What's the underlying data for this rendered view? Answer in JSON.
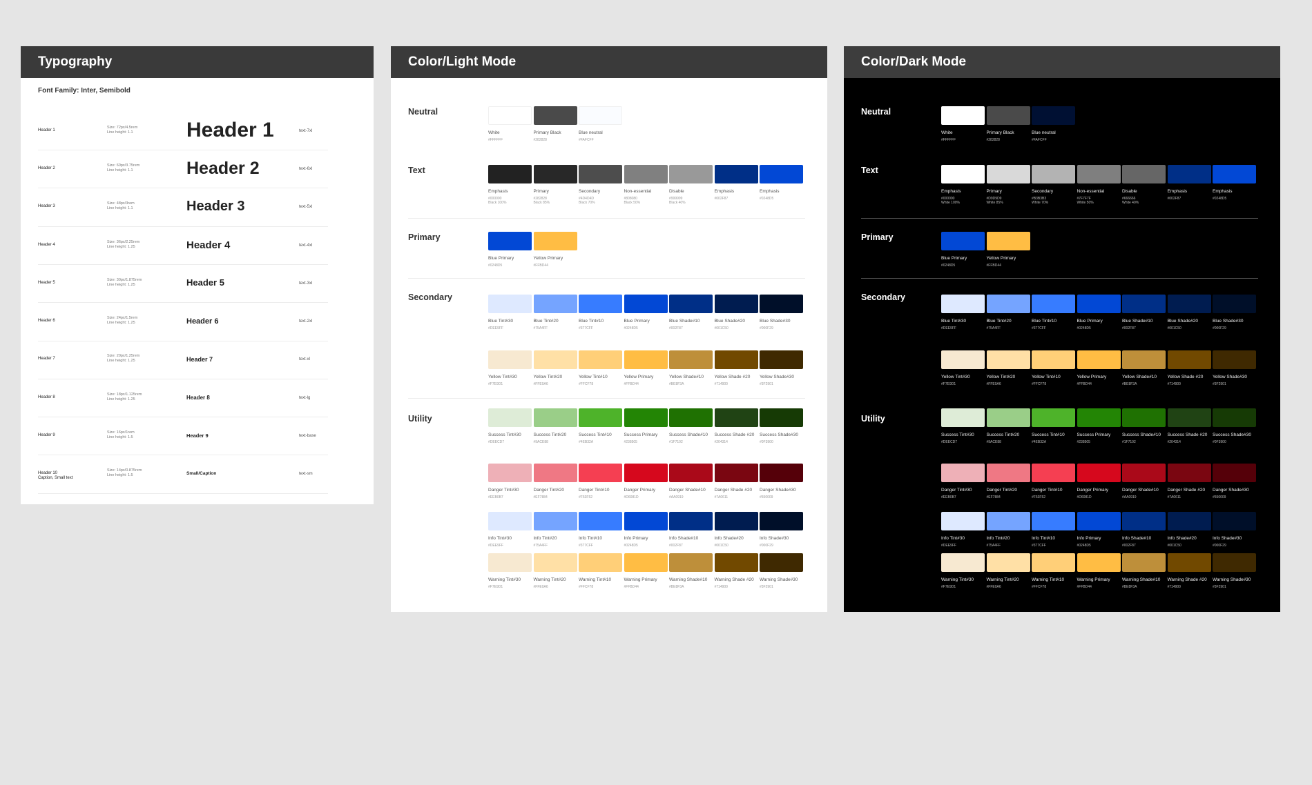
{
  "panels": {
    "typography_title": "Typography",
    "light_title": "Color/Light Mode",
    "dark_title": "Color/Dark Mode"
  },
  "typography": {
    "font_family": "Font Family: Inter, Semibold",
    "rows": [
      {
        "name": "Header 1",
        "size": "Size: 72px/4.5rem",
        "line": "Line height: 1.1",
        "sample": "Header 1",
        "cls": "text-7xl"
      },
      {
        "name": "Header 2",
        "size": "Size: 60px/3.75rem",
        "line": "Line height: 1.1",
        "sample": "Header 2",
        "cls": "text-6xl"
      },
      {
        "name": "Header 3",
        "size": "Size: 48px/3rem",
        "line": "Line height: 1.1",
        "sample": "Header 3",
        "cls": "text-5xl"
      },
      {
        "name": "Header 4",
        "size": "Size: 36px/2.25rem",
        "line": "Line height: 1.25",
        "sample": "Header 4",
        "cls": "text-4xl"
      },
      {
        "name": "Header 5",
        "size": "Size: 30px/1.875rem",
        "line": "Line height: 1.25",
        "sample": "Header 5",
        "cls": "text-3xl"
      },
      {
        "name": "Header 6",
        "size": "Size: 24px/1.5rem",
        "line": "Line height: 1.25",
        "sample": "Header 6",
        "cls": "text-2xl"
      },
      {
        "name": "Header 7",
        "size": "Size: 20px/1.25rem",
        "line": "Line height: 1.25",
        "sample": "Header 7",
        "cls": "text-xl"
      },
      {
        "name": "Header 8",
        "size": "Size: 18px/1.125rem",
        "line": "Line height: 1.25",
        "sample": "Header 8",
        "cls": "text-lg"
      },
      {
        "name": "Header 9",
        "size": "Size: 16px/1rem",
        "line": "Line height: 1.5",
        "sample": "Header 9",
        "cls": "text-base"
      },
      {
        "name": "Header 10\nCaption, Small text",
        "size": "Size: 14px/0.875rem",
        "line": "Line height: 1.5",
        "sample": "Small/Caption",
        "cls": "text-sm"
      }
    ]
  },
  "light": {
    "labels": {
      "neutral": "Neutral",
      "text": "Text",
      "primary": "Primary",
      "secondary": "Secondary",
      "utility": "Utility"
    },
    "neutral": [
      {
        "name": "White",
        "hex": "#FFFFFF",
        "color": "#FFFFFF"
      },
      {
        "name": "Primary Black",
        "hex": "#282828",
        "color": "#4a4a4a"
      },
      {
        "name": "Blue neutral",
        "hex": "#FAFCFF",
        "color": "#FAFCFF"
      }
    ],
    "text": [
      {
        "name": "Emphasis",
        "hex": "#000000",
        "extra": "Black 100%",
        "color": "#222222"
      },
      {
        "name": "Primary",
        "hex": "#282828",
        "extra": "Black 85%",
        "color": "#282828"
      },
      {
        "name": "Secondary",
        "hex": "#4D4D4D",
        "extra": "Black 70%",
        "color": "#4D4D4D"
      },
      {
        "name": "Non-essential",
        "hex": "#808080",
        "extra": "Black 50%",
        "color": "#808080"
      },
      {
        "name": "Disable",
        "hex": "#999999",
        "extra": "Black 40%",
        "color": "#999999"
      },
      {
        "name": "Emphasis",
        "hex": "#002F87",
        "extra": "",
        "color": "#002F87"
      },
      {
        "name": "Emphasis",
        "hex": "#0248D5",
        "extra": "",
        "color": "#0248D5"
      }
    ],
    "primary": [
      {
        "name": "Blue Primary",
        "hex": "#0248D5",
        "color": "#0248D5"
      },
      {
        "name": "Yellow Primary",
        "hex": "#FFBD44",
        "color": "#FFBD44"
      }
    ],
    "secondary_blue": [
      {
        "name": "Blue Tint#30",
        "hex": "#DEE9FF",
        "color": "#DEE9FF"
      },
      {
        "name": "Blue Tint#20",
        "hex": "#75A4FF",
        "color": "#75A4FF"
      },
      {
        "name": "Blue Tint#10",
        "hex": "#377CFF",
        "color": "#377CFF"
      },
      {
        "name": "Blue Primary",
        "hex": "#0248D5",
        "color": "#0248D5"
      },
      {
        "name": "Blue Shade#10",
        "hex": "#002F87",
        "color": "#002F87"
      },
      {
        "name": "Blue Shade#20",
        "hex": "#001C50",
        "color": "#001C50"
      },
      {
        "name": "Blue Shade#30",
        "hex": "#000F29",
        "color": "#000F29"
      }
    ],
    "secondary_yellow": [
      {
        "name": "Yellow Tint#30",
        "hex": "#F7E9D1",
        "color": "#F7E9D1"
      },
      {
        "name": "Yellow Tint#20",
        "hex": "#FFE0A6",
        "color": "#FFE0A6"
      },
      {
        "name": "Yellow Tint#10",
        "hex": "#FFCF78",
        "color": "#FFCF78"
      },
      {
        "name": "Yellow Primary",
        "hex": "#FFBD44",
        "color": "#FFBD44"
      },
      {
        "name": "Yellow Shade#10",
        "hex": "#BE8F3A",
        "color": "#BE8F3A"
      },
      {
        "name": "Yellow Shade #20",
        "hex": "#714900",
        "color": "#714900"
      },
      {
        "name": "Yellow Shade#30",
        "hex": "#3F2901",
        "color": "#3F2901"
      }
    ],
    "success": [
      {
        "name": "Success Tint#30",
        "hex": "#DEECD7",
        "color": "#DEECD7"
      },
      {
        "name": "Success Tint#20",
        "hex": "#9ACE88",
        "color": "#9ACE88"
      },
      {
        "name": "Success Tint#10",
        "hex": "#4EB32A",
        "color": "#4EB32A"
      },
      {
        "name": "Success Primary",
        "hex": "#238505",
        "color": "#238505"
      },
      {
        "name": "Success Shade#10",
        "hex": "#1F7102",
        "color": "#1F7102"
      },
      {
        "name": "Success Shade #20",
        "hex": "#204314",
        "color": "#204314"
      },
      {
        "name": "Success Shade#30",
        "hex": "#0F3900",
        "color": "#163A05"
      }
    ],
    "danger": [
      {
        "name": "Danger Tint#30",
        "hex": "#EEB0B7",
        "color": "#EEB0B7"
      },
      {
        "name": "Danger Tint#20",
        "hex": "#EF7884",
        "color": "#EF7884"
      },
      {
        "name": "Danger Tint#10",
        "hex": "#F53F52",
        "color": "#F53F52"
      },
      {
        "name": "Danger Primary",
        "hex": "#D6081D",
        "color": "#D6081D"
      },
      {
        "name": "Danger Shade#10",
        "hex": "#AA0919",
        "color": "#AA0919"
      },
      {
        "name": "Danger Shade #20",
        "hex": "#7A0611",
        "color": "#7A0611"
      },
      {
        "name": "Danger Shade#30",
        "hex": "#550009",
        "color": "#550009"
      }
    ],
    "info": [
      {
        "name": "Info Tint#30",
        "hex": "#DEE9FF",
        "color": "#DEE9FF"
      },
      {
        "name": "Info Tint#20",
        "hex": "#75A4FF",
        "color": "#75A4FF"
      },
      {
        "name": "Info Tint#10",
        "hex": "#377CFF",
        "color": "#377CFF"
      },
      {
        "name": "Info Primary",
        "hex": "#0248D5",
        "color": "#0248D5"
      },
      {
        "name": "Info Shade#10",
        "hex": "#002F87",
        "color": "#002F87"
      },
      {
        "name": "Info Shade#20",
        "hex": "#001C50",
        "color": "#001C50"
      },
      {
        "name": "Info Shade#30",
        "hex": "#000F29",
        "color": "#000F29"
      }
    ],
    "warning": [
      {
        "name": "Warning Tint#30",
        "hex": "#F7E9D1",
        "color": "#F7E9D1"
      },
      {
        "name": "Warning Tint#20",
        "hex": "#FFE0A6",
        "color": "#FFE0A6"
      },
      {
        "name": "Warning Tint#10",
        "hex": "#FFCF78",
        "color": "#FFCF78"
      },
      {
        "name": "Warning Primary",
        "hex": "#FFBD44",
        "color": "#FFBD44"
      },
      {
        "name": "Warning Shade#10",
        "hex": "#BE8F3A",
        "color": "#BE8F3A"
      },
      {
        "name": "Warning Shade #20",
        "hex": "#714900",
        "color": "#714900"
      },
      {
        "name": "Warning Shade#30",
        "hex": "#3F2901",
        "color": "#3F2901"
      }
    ]
  },
  "dark": {
    "labels": {
      "neutral": "Neutral",
      "text": "Text",
      "primary": "Primary",
      "secondary": "Secondary",
      "utility": "Utility"
    },
    "neutral": [
      {
        "name": "White",
        "hex": "#FFFFFF",
        "color": "#FFFFFF"
      },
      {
        "name": "Primary Black",
        "hex": "#282828",
        "color": "#4a4a4a"
      },
      {
        "name": "Blue neutral",
        "hex": "#FAFCFF",
        "color": "#001033"
      }
    ],
    "text": [
      {
        "name": "Emphasis",
        "hex": "#000000",
        "extra": "White 100%",
        "color": "#FFFFFF"
      },
      {
        "name": "Primary",
        "hex": "#D9D9D9",
        "extra": "White 85%",
        "color": "#D9D9D9"
      },
      {
        "name": "Secondary",
        "hex": "#B3B3B3",
        "extra": "White 70%",
        "color": "#B3B3B3"
      },
      {
        "name": "Non-essential",
        "hex": "#7F7F7F",
        "extra": "White 50%",
        "color": "#7F7F7F"
      },
      {
        "name": "Disable",
        "hex": "#666666",
        "extra": "White 40%",
        "color": "#666666"
      },
      {
        "name": "Emphasis",
        "hex": "#002F87",
        "extra": "",
        "color": "#002F87"
      },
      {
        "name": "Emphasis",
        "hex": "#0248D5",
        "extra": "",
        "color": "#0248D5"
      }
    ],
    "primary": [
      {
        "name": "Blue Primary",
        "hex": "#0248D5",
        "color": "#0248D5"
      },
      {
        "name": "Yellow Primary",
        "hex": "#FFBD44",
        "color": "#FFBD44"
      }
    ],
    "secondary_blue": [
      {
        "name": "Blue Tint#30",
        "hex": "#DEE9FF",
        "color": "#DEE9FF"
      },
      {
        "name": "Blue Tint#20",
        "hex": "#75A4FF",
        "color": "#75A4FF"
      },
      {
        "name": "Blue Tint#10",
        "hex": "#377CFF",
        "color": "#377CFF"
      },
      {
        "name": "Blue Primary",
        "hex": "#0248D5",
        "color": "#0248D5"
      },
      {
        "name": "Blue Shade#10",
        "hex": "#002F87",
        "color": "#002F87"
      },
      {
        "name": "Blue Shade#20",
        "hex": "#001C50",
        "color": "#001C50"
      },
      {
        "name": "Blue Shade#30",
        "hex": "#000F29",
        "color": "#000F29"
      }
    ],
    "secondary_yellow": [
      {
        "name": "Yellow Tint#30",
        "hex": "#F7E9D1",
        "color": "#F7E9D1"
      },
      {
        "name": "Yellow Tint#20",
        "hex": "#FFE0A6",
        "color": "#FFE0A6"
      },
      {
        "name": "Yellow Tint#10",
        "hex": "#FFCF78",
        "color": "#FFCF78"
      },
      {
        "name": "Yellow Primary",
        "hex": "#FFBD44",
        "color": "#FFBD44"
      },
      {
        "name": "Yellow Shade#10",
        "hex": "#BE8F3A",
        "color": "#BE8F3A"
      },
      {
        "name": "Yellow Shade #20",
        "hex": "#714900",
        "color": "#714900"
      },
      {
        "name": "Yellow Shade#30",
        "hex": "#3F2901",
        "color": "#3F2901"
      }
    ],
    "success": [
      {
        "name": "Success Tint#30",
        "hex": "#DEECD7",
        "color": "#DEECD7"
      },
      {
        "name": "Success Tint#20",
        "hex": "#9ACE88",
        "color": "#9ACE88"
      },
      {
        "name": "Success Tint#10",
        "hex": "#4EB32A",
        "color": "#4EB32A"
      },
      {
        "name": "Success Primary",
        "hex": "#238505",
        "color": "#238505"
      },
      {
        "name": "Success Shade#10",
        "hex": "#1F7102",
        "color": "#1F7102"
      },
      {
        "name": "Success Shade #20",
        "hex": "#204314",
        "color": "#204314"
      },
      {
        "name": "Success Shade#30",
        "hex": "#0F3900",
        "color": "#163A05"
      }
    ],
    "danger": [
      {
        "name": "Danger Tint#30",
        "hex": "#EEB0B7",
        "color": "#EEB0B7"
      },
      {
        "name": "Danger Tint#20",
        "hex": "#EF7884",
        "color": "#EF7884"
      },
      {
        "name": "Danger Tint#10",
        "hex": "#F53F52",
        "color": "#F53F52"
      },
      {
        "name": "Danger Primary",
        "hex": "#D6081D",
        "color": "#D6081D"
      },
      {
        "name": "Danger Shade#10",
        "hex": "#AA0919",
        "color": "#AA0919"
      },
      {
        "name": "Danger Shade #20",
        "hex": "#7A0611",
        "color": "#7A0611"
      },
      {
        "name": "Danger Shade#30",
        "hex": "#550009",
        "color": "#550009"
      }
    ],
    "info": [
      {
        "name": "Info Tint#30",
        "hex": "#DEE9FF",
        "color": "#DEE9FF"
      },
      {
        "name": "Info Tint#20",
        "hex": "#75A4FF",
        "color": "#75A4FF"
      },
      {
        "name": "Info Tint#10",
        "hex": "#377CFF",
        "color": "#377CFF"
      },
      {
        "name": "Info Primary",
        "hex": "#0248D5",
        "color": "#0248D5"
      },
      {
        "name": "Info Shade#10",
        "hex": "#002F87",
        "color": "#002F87"
      },
      {
        "name": "Info Shade#20",
        "hex": "#001C50",
        "color": "#001C50"
      },
      {
        "name": "Info Shade#30",
        "hex": "#000F29",
        "color": "#000F29"
      }
    ],
    "warning": [
      {
        "name": "Warning Tint#30",
        "hex": "#F7E9D1",
        "color": "#F7E9D1"
      },
      {
        "name": "Warning Tint#20",
        "hex": "#FFE0A6",
        "color": "#FFE0A6"
      },
      {
        "name": "Warning Tint#10",
        "hex": "#FFCF78",
        "color": "#FFCF78"
      },
      {
        "name": "Warning Primary",
        "hex": "#FFBD44",
        "color": "#FFBD44"
      },
      {
        "name": "Warning Shade#10",
        "hex": "#BE8F3A",
        "color": "#BE8F3A"
      },
      {
        "name": "Warning Shade #20",
        "hex": "#714900",
        "color": "#714900"
      },
      {
        "name": "Warning Shade#30",
        "hex": "#3F2901",
        "color": "#3F2901"
      }
    ]
  }
}
